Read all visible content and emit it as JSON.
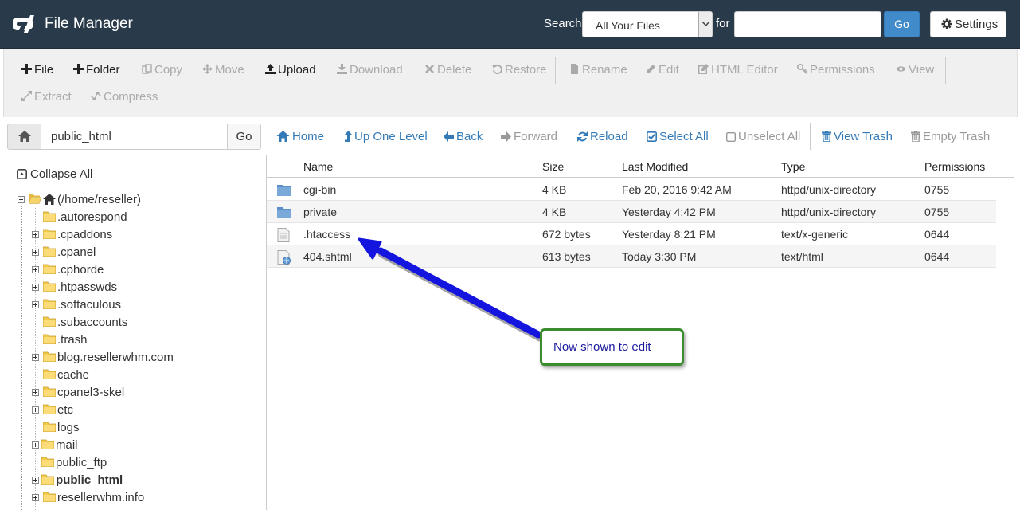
{
  "header": {
    "title": "File Manager",
    "search_label": "Search",
    "search_scope": "All Your Files",
    "for_label": "for",
    "search_value": "",
    "go_label": "Go",
    "settings_label": "Settings"
  },
  "toolbar": {
    "file": "File",
    "folder": "Folder",
    "copy": "Copy",
    "move": "Move",
    "upload": "Upload",
    "download": "Download",
    "delete": "Delete",
    "restore": "Restore",
    "rename": "Rename",
    "edit": "Edit",
    "html_editor": "HTML Editor",
    "permissions": "Permissions",
    "view": "View",
    "extract": "Extract",
    "compress": "Compress"
  },
  "pathbar": {
    "path": "public_html",
    "go_label": "Go"
  },
  "nav": {
    "home": "Home",
    "up_one_level": "Up One Level",
    "back": "Back",
    "forward": "Forward",
    "reload": "Reload",
    "select_all": "Select All",
    "unselect_all": "Unselect All",
    "view_trash": "View Trash",
    "empty_trash": "Empty Trash"
  },
  "tree": {
    "collapse_all": "Collapse All",
    "root": "(/home/reseller)",
    "items": [
      ".autorespond",
      ".cpaddons",
      ".cpanel",
      ".cphorde",
      ".htpasswds",
      ".softaculous",
      ".subaccounts",
      ".trash",
      "blog.resellerwhm.com",
      "cache",
      "cpanel3-skel",
      "etc",
      "logs",
      "mail",
      "public_ftp",
      "public_html",
      "resellerwhm.info"
    ]
  },
  "file_list": {
    "columns": [
      "Name",
      "Size",
      "Last Modified",
      "Type",
      "Permissions"
    ],
    "rows": [
      {
        "name": "cgi-bin",
        "size": "4 KB",
        "modified": "Feb 20, 2016 9:42 AM",
        "type": "httpd/unix-directory",
        "perms": "0755",
        "icon": "folder-icon"
      },
      {
        "name": "private",
        "size": "4 KB",
        "modified": "Yesterday 4:42 PM",
        "type": "httpd/unix-directory",
        "perms": "0755",
        "icon": "folder-icon"
      },
      {
        "name": ".htaccess",
        "size": "672 bytes",
        "modified": "Yesterday 8:21 PM",
        "type": "text/x-generic",
        "perms": "0644",
        "icon": "text-file-icon"
      },
      {
        "name": "404.shtml",
        "size": "613 bytes",
        "modified": "Today 3:30 PM",
        "type": "text/html",
        "perms": "0644",
        "icon": "html-file-icon"
      }
    ]
  },
  "annotation": {
    "text": "Now shown to edit",
    "arrow_color": "#1515e0",
    "border_color": "#3a8c2e"
  },
  "colors": {
    "header_bg": "#293a4a",
    "accent": "#428bca",
    "link": "#337ab7"
  }
}
